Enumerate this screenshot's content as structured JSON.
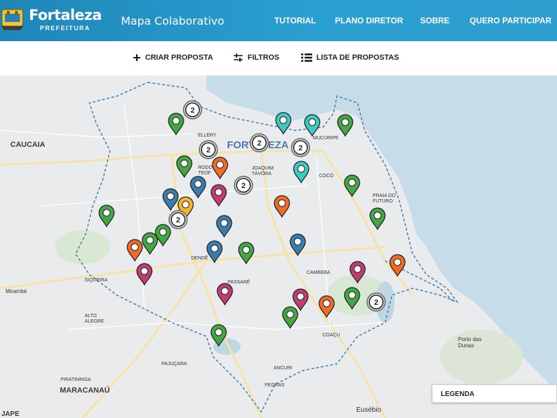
{
  "header": {
    "brand": "Fortaleza",
    "brand_sub": "PREFEITURA",
    "app_title": "Mapa Colaborativo",
    "nav": [
      "TUTORIAL",
      "PLANO DIRETOR",
      "SOBRE",
      "QUERO PARTICIPAR"
    ]
  },
  "toolbar": {
    "create": "CRIAR PROPOSTA",
    "filters": "FILTROS",
    "list": "LISTA DE PROPOSTAS"
  },
  "colors": {
    "header": "#2a9fd1",
    "green": "#43a843",
    "teal": "#3ec9c4",
    "orange": "#f06a28",
    "blue": "#3a7dae",
    "magenta": "#bf3f72",
    "yellow": "#f5b62a",
    "cluster": "#333333",
    "sea": "#c6dde9"
  },
  "map": {
    "labels": [
      {
        "name": "label-caucaia",
        "text": "CAUCAIA"
      },
      {
        "name": "label-fortaleza",
        "text": "FORTALEZA"
      },
      {
        "name": "label-mucuripe",
        "text": "MUCURIPE"
      },
      {
        "name": "label-joaquim-tavora",
        "text": "JOAQUIM TÁVORA"
      },
      {
        "name": "label-coco",
        "text": "COCÓ"
      },
      {
        "name": "label-praia-do-futuro",
        "text": "PRAIA DO FUTURO"
      },
      {
        "name": "label-dende",
        "text": "DENDÊ"
      },
      {
        "name": "label-siqueira",
        "text": "SIQUEIRA"
      },
      {
        "name": "label-passare",
        "text": "PASSARÉ"
      },
      {
        "name": "label-cambeba",
        "text": "CAMBEBA"
      },
      {
        "name": "label-mirambe",
        "text": "Mirambé"
      },
      {
        "name": "label-alto-alegre",
        "text": "ALTO ALEGRE"
      },
      {
        "name": "label-coacu",
        "text": "COAÇU"
      },
      {
        "name": "label-porto-das-dunas",
        "text": "Porto das Dunas"
      },
      {
        "name": "label-pajucara",
        "text": "PAJUÇARA"
      },
      {
        "name": "label-ancuri",
        "text": "ANCURI"
      },
      {
        "name": "label-piratininga",
        "text": "PIRATININGA"
      },
      {
        "name": "label-maracanau",
        "text": "MARACANAÚ"
      },
      {
        "name": "label-pedras",
        "text": "PEDRAS"
      },
      {
        "name": "label-eusebio",
        "text": "Eusébio"
      },
      {
        "name": "label-jape",
        "text": "JAPE"
      },
      {
        "name": "label-rodolfo-teofilo",
        "text": "RODO TEÓF"
      },
      {
        "name": "label-ellery",
        "text": "ELLERY"
      }
    ],
    "markers": [
      {
        "color": "green"
      },
      {
        "color": "green"
      },
      {
        "color": "green"
      },
      {
        "color": "green"
      },
      {
        "color": "green"
      },
      {
        "color": "green"
      },
      {
        "color": "green"
      },
      {
        "color": "green"
      },
      {
        "color": "green"
      },
      {
        "color": "green"
      },
      {
        "color": "green"
      },
      {
        "color": "green"
      },
      {
        "color": "teal"
      },
      {
        "color": "teal"
      },
      {
        "color": "teal"
      },
      {
        "color": "orange"
      },
      {
        "color": "orange"
      },
      {
        "color": "orange"
      },
      {
        "color": "orange"
      },
      {
        "color": "orange"
      },
      {
        "color": "blue"
      },
      {
        "color": "blue"
      },
      {
        "color": "blue"
      },
      {
        "color": "blue"
      },
      {
        "color": "blue"
      },
      {
        "color": "magenta"
      },
      {
        "color": "magenta"
      },
      {
        "color": "magenta"
      },
      {
        "color": "magenta"
      },
      {
        "color": "magenta"
      },
      {
        "color": "yellow"
      }
    ],
    "clusters": [
      "2",
      "2",
      "2",
      "2",
      "2",
      "2",
      "2"
    ]
  },
  "legend": {
    "label": "LEGENDA"
  }
}
